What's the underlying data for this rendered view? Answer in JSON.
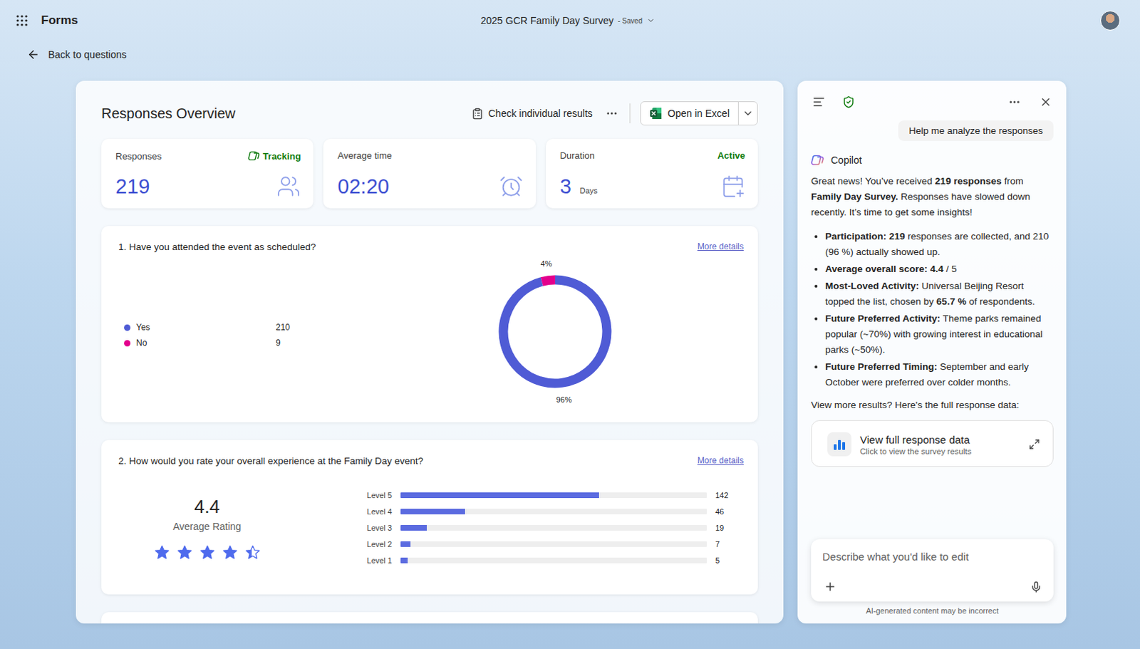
{
  "app": {
    "name": "Forms"
  },
  "document": {
    "title": "2025 GCR Family Day Survey",
    "status": "- Saved"
  },
  "navigation": {
    "back": "Back to questions"
  },
  "overview": {
    "title": "Responses Overview",
    "individual_results": "Check individual results",
    "open_in_excel": "Open in Excel"
  },
  "stats": [
    {
      "label": "Responses",
      "badge": "Tracking",
      "value": "219",
      "kind": "responses"
    },
    {
      "label": "Average time",
      "value": "02:20",
      "kind": "time"
    },
    {
      "label": "Duration",
      "badge": "Active",
      "value": "3",
      "unit": "Days",
      "kind": "duration"
    }
  ],
  "questions": [
    {
      "title": "1. Have you attended the event as scheduled?",
      "link": "More details",
      "kind": "donut",
      "options": [
        {
          "label": "Yes",
          "count": "210",
          "value": 210,
          "percent": "96%",
          "color": "#4f5bd5"
        },
        {
          "label": "No",
          "count": "9",
          "value": 9,
          "percent": "4%",
          "color": "#e3008c"
        }
      ]
    },
    {
      "title": "2. How would you rate your overall experience at the Family Day event?",
      "link": "More details",
      "kind": "rating",
      "average": "4.4",
      "average_label": "Average Rating",
      "stars": 4.4,
      "levels": [
        {
          "label": "Level 5",
          "count": "142",
          "value": 142
        },
        {
          "label": "Level 4",
          "count": "46",
          "value": 46
        },
        {
          "label": "Level 3",
          "count": "19",
          "value": 19
        },
        {
          "label": "Level 2",
          "count": "7",
          "value": 7
        },
        {
          "label": "Level 1",
          "count": "5",
          "value": 5
        }
      ]
    }
  ],
  "copilot": {
    "prompt": "Help me analyze the responses",
    "name": "Copilot",
    "intro": [
      {
        "text": "Great news! You’ve received ",
        "bold": false
      },
      {
        "text": "219 responses",
        "bold": true
      },
      {
        "text": " from ",
        "bold": false
      },
      {
        "text": "Family Day Survey.",
        "bold": true
      },
      {
        "text": " Responses have slowed down recently. It’s time to get some insights!",
        "bold": false
      }
    ],
    "bullets": [
      [
        {
          "text": "Participation:",
          "bold": true
        },
        {
          "text": " ",
          "bold": false
        },
        {
          "text": "219",
          "bold": true
        },
        {
          "text": " responses are collected, and 210 (96 %) actually showed up.",
          "bold": false
        }
      ],
      [
        {
          "text": "Average overall score: 4.4",
          "bold": true
        },
        {
          "text": " / 5",
          "bold": false
        }
      ],
      [
        {
          "text": "Most-Loved Activity:",
          "bold": true
        },
        {
          "text": " Universal Beijing Resort topped the list, chosen by ",
          "bold": false
        },
        {
          "text": "65.7 %",
          "bold": true
        },
        {
          "text": " of respondents.",
          "bold": false
        }
      ],
      [
        {
          "text": "Future Preferred Activity:",
          "bold": true
        },
        {
          "text": " Theme parks remained popular (~70%) with growing interest in educational parks (~50%).",
          "bold": false
        }
      ],
      [
        {
          "text": "Future Preferred Timing:",
          "bold": true
        },
        {
          "text": " September and early October were preferred over colder months.",
          "bold": false
        }
      ]
    ],
    "more_prompt": "View more results? Here's the full response data:",
    "card": {
      "title": "View full response data",
      "subtitle": "Click to view the survey results"
    },
    "input_placeholder": "Describe what you'd like to edit",
    "disclaimer": "AI-generated content may be incorrect"
  }
}
